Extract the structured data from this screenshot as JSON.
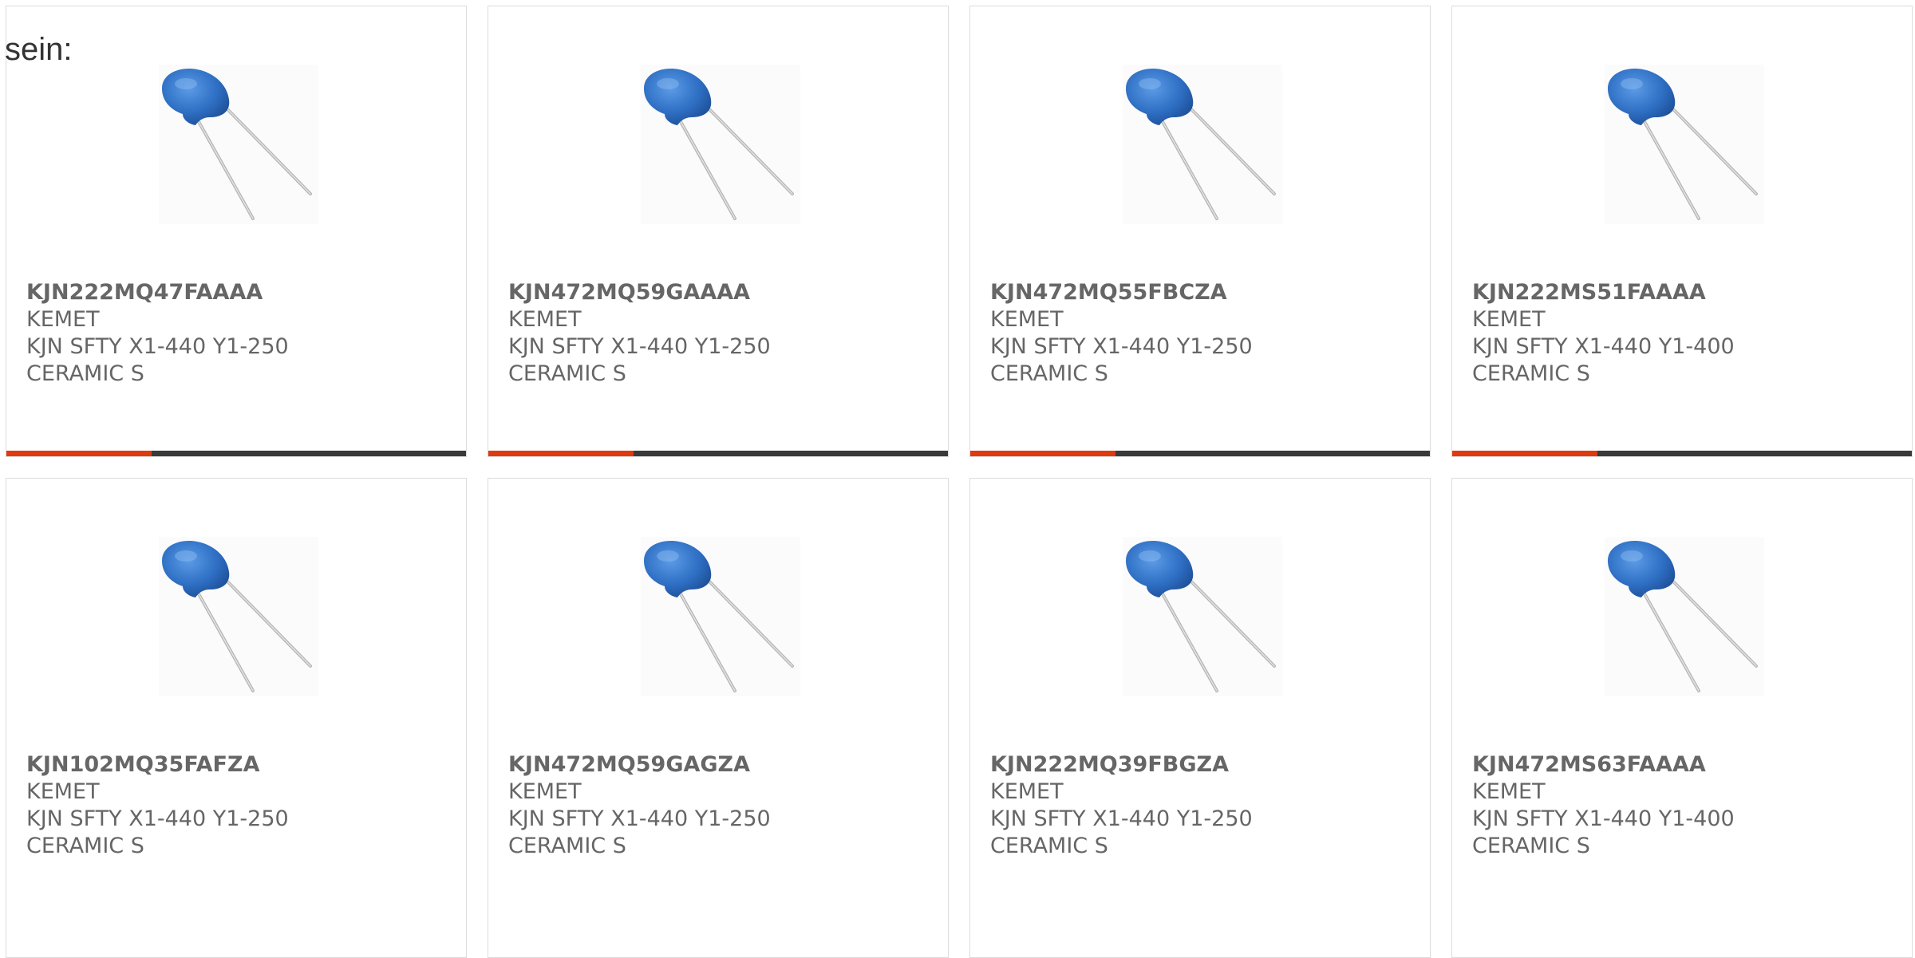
{
  "intro_text": "sein:",
  "colors": {
    "accent": "#e03a10",
    "bar": "#3a3a3a",
    "text": "#666666",
    "capacitor_body": "#2f6fc4"
  },
  "products": [
    {
      "part_number": "KJN222MQ47FAAAA",
      "manufacturer": "KEMET",
      "desc_line1": "KJN SFTY X1-440 Y1-250",
      "desc_line2": "CERAMIC S",
      "image_icon": "ceramic-disc-capacitor-icon"
    },
    {
      "part_number": "KJN472MQ59GAAAA",
      "manufacturer": "KEMET",
      "desc_line1": "KJN SFTY X1-440 Y1-250",
      "desc_line2": "CERAMIC S",
      "image_icon": "ceramic-disc-capacitor-icon"
    },
    {
      "part_number": "KJN472MQ55FBCZA",
      "manufacturer": "KEMET",
      "desc_line1": "KJN SFTY X1-440 Y1-250",
      "desc_line2": "CERAMIC S",
      "image_icon": "ceramic-disc-capacitor-icon"
    },
    {
      "part_number": "KJN222MS51FAAAA",
      "manufacturer": "KEMET",
      "desc_line1": "KJN SFTY X1-440 Y1-400",
      "desc_line2": "CERAMIC S",
      "image_icon": "ceramic-disc-capacitor-icon"
    },
    {
      "part_number": "KJN102MQ35FAFZA",
      "manufacturer": "KEMET",
      "desc_line1": "KJN SFTY X1-440 Y1-250",
      "desc_line2": "CERAMIC S",
      "image_icon": "ceramic-disc-capacitor-icon"
    },
    {
      "part_number": "KJN472MQ59GAGZA",
      "manufacturer": "KEMET",
      "desc_line1": "KJN SFTY X1-440 Y1-250",
      "desc_line2": "CERAMIC S",
      "image_icon": "ceramic-disc-capacitor-icon"
    },
    {
      "part_number": "KJN222MQ39FBGZA",
      "manufacturer": "KEMET",
      "desc_line1": "KJN SFTY X1-440 Y1-250",
      "desc_line2": "CERAMIC S",
      "image_icon": "ceramic-disc-capacitor-icon"
    },
    {
      "part_number": "KJN472MS63FAAAA",
      "manufacturer": "KEMET",
      "desc_line1": "KJN SFTY X1-440 Y1-400",
      "desc_line2": "CERAMIC S",
      "image_icon": "ceramic-disc-capacitor-icon"
    }
  ]
}
